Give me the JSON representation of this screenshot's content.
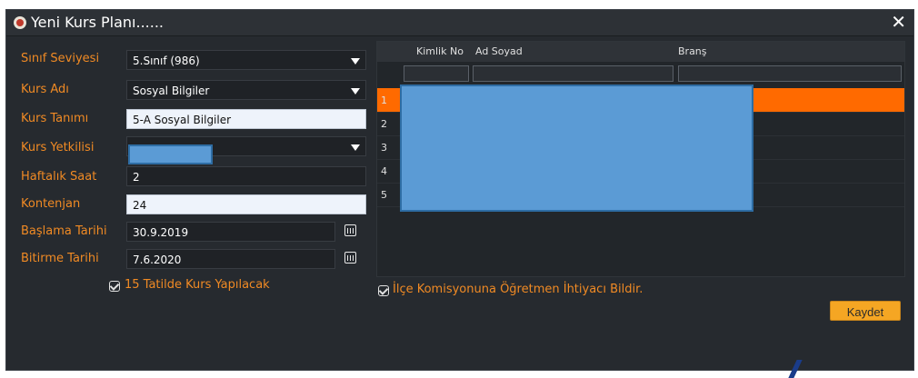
{
  "window": {
    "title": "Yeni Kurs Planı......",
    "close_glyph": "✕"
  },
  "form": {
    "sinif_seviyesi": {
      "label": "Sınıf Seviyesi",
      "value": "5.Sınıf (986)"
    },
    "kurs_adi": {
      "label": "Kurs Adı",
      "value": "Sosyal Bilgiler"
    },
    "kurs_tanimi": {
      "label": "Kurs Tanımı",
      "value": "5-A Sosyal Bilgiler"
    },
    "kurs_yetkilisi": {
      "label": "Kurs Yetkilisi",
      "value": ""
    },
    "haftalik_saat": {
      "label": "Haftalık Saat",
      "value": "2"
    },
    "kontenjan": {
      "label": "Kontenjan",
      "value": "24"
    },
    "baslama_tarihi": {
      "label": "Başlama Tarihi",
      "value": "30.9.2019"
    },
    "bitirme_tarihi": {
      "label": "Bitirme Tarihi",
      "value": "7.6.2020"
    },
    "tatil_checkbox": {
      "label": "15 Tatilde Kurs Yapılacak",
      "checked": true
    }
  },
  "grid": {
    "columns": [
      "Kimlik No",
      "Ad Soyad",
      "Branş"
    ],
    "rows": [
      {
        "num": "1",
        "selected": true
      },
      {
        "num": "2",
        "selected": false
      },
      {
        "num": "3",
        "selected": false
      },
      {
        "num": "4",
        "selected": false
      },
      {
        "num": "5",
        "selected": false
      }
    ]
  },
  "ilce_checkbox": {
    "label": "İlçe Komisyonuna Öğretmen İhtiyacı Bildir.",
    "checked": true
  },
  "actions": {
    "save_label": "Kaydet"
  },
  "colors": {
    "accent_orange": "#f08a24",
    "selected_row": "#ff6a00",
    "save_button": "#f5a623",
    "redaction": "#5b9bd5"
  }
}
